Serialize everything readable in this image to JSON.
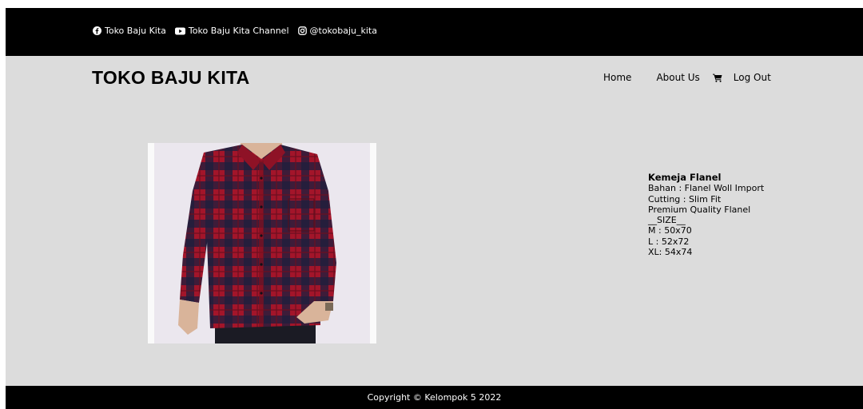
{
  "topbar": {
    "social": [
      {
        "icon": "facebook-icon",
        "label": "Toko Baju Kita"
      },
      {
        "icon": "youtube-icon",
        "label": "Toko Baju Kita Channel"
      },
      {
        "icon": "instagram-icon",
        "label": "@tokobaju_kita"
      }
    ]
  },
  "header": {
    "brand": "TOKO BAJU KITA",
    "nav": {
      "home": "Home",
      "about": "About Us",
      "cart_icon": "cart-icon",
      "logout": "Log Out"
    }
  },
  "product": {
    "image_icon": "product-photo",
    "title": "Kemeja Flanel",
    "details": [
      "Bahan : Flanel Woll Import",
      "Cutting : Slim Fit",
      "Premium Quality Flanel",
      "__SIZE__",
      "M : 50x70",
      "L : 52x72",
      "XL: 54x74"
    ]
  },
  "footer": {
    "copyright": "Copyright © Kelompok 5 2022"
  },
  "colors": {
    "topbar": "#000000",
    "page": "#dcdcdc",
    "shirt_red": "#a3152a",
    "shirt_navy": "#1c1f3d"
  }
}
